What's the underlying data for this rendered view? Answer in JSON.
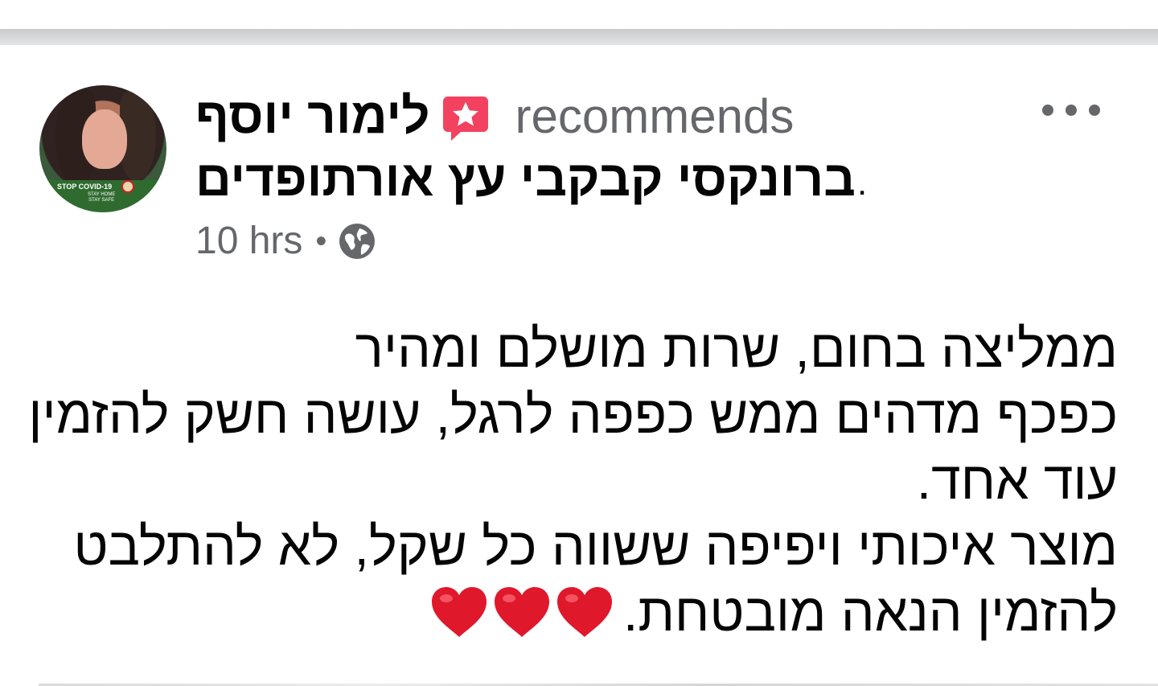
{
  "post": {
    "author": "לימור יוסף",
    "action": "recommends",
    "page": "ברונקסי קבקבי עץ אורתופדים",
    "page_suffix": ".",
    "time": "10 hrs",
    "separator": "•",
    "privacy_icon": "globe-icon",
    "recommend_icon": "star-speech-bubble-icon",
    "more_icon": "more-horizontal-icon",
    "avatar_text": {
      "main": "STOP COVID-19",
      "sub": "STAY HOME\nSTAY SAFE"
    },
    "lines": [
      "ממליצה בחום, שרות מושלם ומהיר",
      "כפכף מדהים ממש כפפה לרגל, עושה חשק להזמין",
      "עוד אחד.",
      "מוצר איכותי ויפיפה ששווה כל שקל, לא להתלבט",
      "להזמין הנאה מובטחת."
    ],
    "hearts_count": 3
  },
  "colors": {
    "text_primary": "#050505",
    "text_secondary": "#65676b",
    "recommend_icon": "#f3425f",
    "heart": "#e0182c"
  }
}
